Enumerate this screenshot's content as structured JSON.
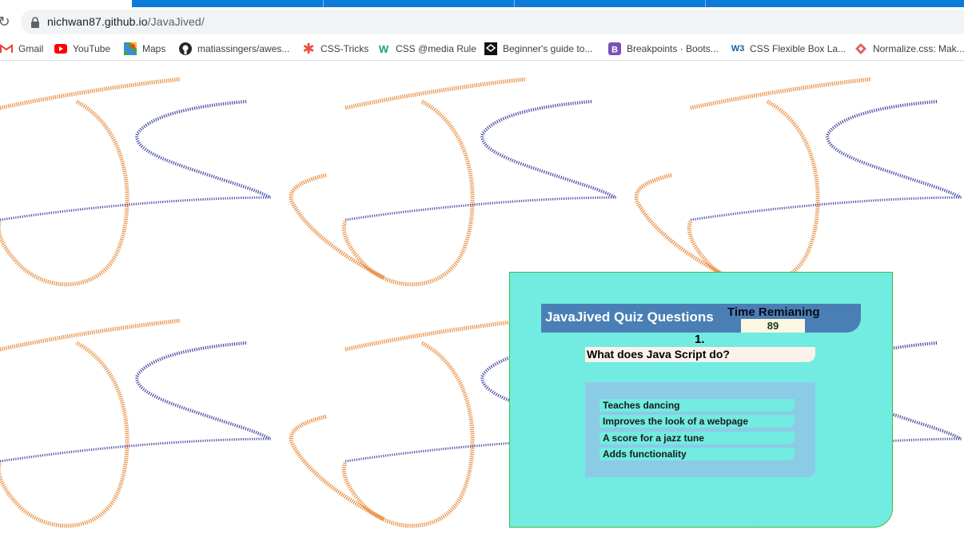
{
  "browser": {
    "url_host": "nichwan87.github.io",
    "url_path": "/JavaJived/",
    "bookmarks": [
      {
        "label": "Gmail",
        "icon": "gmail-icon"
      },
      {
        "label": "YouTube",
        "icon": "youtube-icon"
      },
      {
        "label": "Maps",
        "icon": "maps-icon"
      },
      {
        "label": "matiassingers/awes...",
        "icon": "github-icon"
      },
      {
        "label": "CSS-Tricks",
        "icon": "css-tricks-icon"
      },
      {
        "label": "CSS @media Rule",
        "icon": "w3schools-icon"
      },
      {
        "label": "Beginner's guide to...",
        "icon": "codepen-icon"
      },
      {
        "label": "Breakpoints · Boots...",
        "icon": "bootstrap-icon"
      },
      {
        "label": "CSS Flexible Box La...",
        "icon": "w3c-icon"
      },
      {
        "label": "Normalize.css: Mak...",
        "icon": "normalize-icon"
      }
    ]
  },
  "quiz": {
    "title": "JavaJived Quiz Questions",
    "time_label": "Time Remianing",
    "time_value": "89",
    "question_number": "1.",
    "question_text": "What does Java Script do?",
    "choices": [
      "Teaches dancing",
      "Improves the look of a webpage",
      "A score for a jazz tune",
      "Adds functionality"
    ]
  },
  "colors": {
    "orange_stroke": "#e8893a",
    "blue_stroke": "#3b3fa0",
    "quiz_bg": "#72ebe0",
    "header_bg": "#4a7fb5",
    "choices_bg": "#8ccbe6"
  }
}
